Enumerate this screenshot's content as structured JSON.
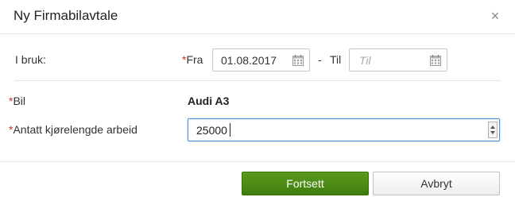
{
  "dialog": {
    "title": "Ny Firmabilavtale",
    "close_glyph": "×"
  },
  "form": {
    "i_bruk_label": "I bruk:",
    "required_mark": "*",
    "fra_label": "Fra",
    "fra_value": "01.08.2017",
    "dash": "-",
    "til_label": "Til",
    "til_placeholder": "Til",
    "bil_label": "Bil",
    "bil_value": "Audi A3",
    "antatt_label": "Antatt kjørelengde arbeid",
    "antatt_value": "25000"
  },
  "buttons": {
    "continue_label": "Fortsett",
    "cancel_label": "Avbryt"
  },
  "icons": {
    "calendar": "calendar-icon",
    "close": "close-icon",
    "spinner": "number-spinner"
  },
  "colors": {
    "primary_button": "#4a8c14",
    "required": "#c0392b",
    "focus_border": "#4a90d9"
  }
}
